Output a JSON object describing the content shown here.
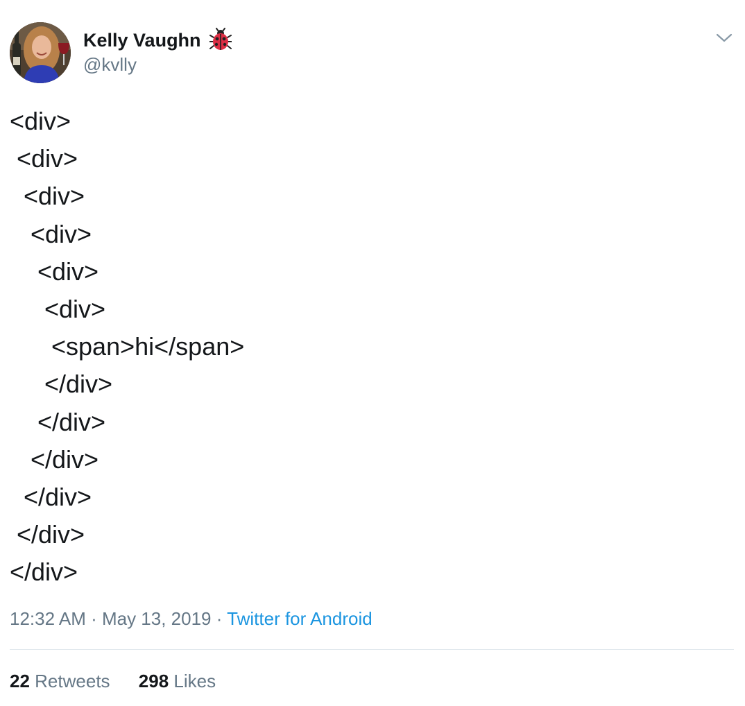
{
  "author": {
    "display_name": "Kelly Vaughn",
    "name_emoji": "ladybug-icon",
    "handle": "@kvlly"
  },
  "tweet": {
    "lines": [
      "<div>",
      " <div>",
      "  <div>",
      "   <div>",
      "    <div>",
      "     <div>",
      "      <span>hi</span>",
      "     </div>",
      "    </div>",
      "   </div>",
      "  </div>",
      " </div>",
      "</div>"
    ]
  },
  "meta": {
    "time": "12:32 AM",
    "separator": " · ",
    "date": "May 13, 2019",
    "source": "Twitter for Android"
  },
  "stats": {
    "retweets_count": "22",
    "retweets_label": "Retweets",
    "likes_count": "298",
    "likes_label": "Likes"
  },
  "colors": {
    "text": "#14171a",
    "muted": "#657786",
    "link": "#1b95e0",
    "divider": "#e1e8ed"
  }
}
